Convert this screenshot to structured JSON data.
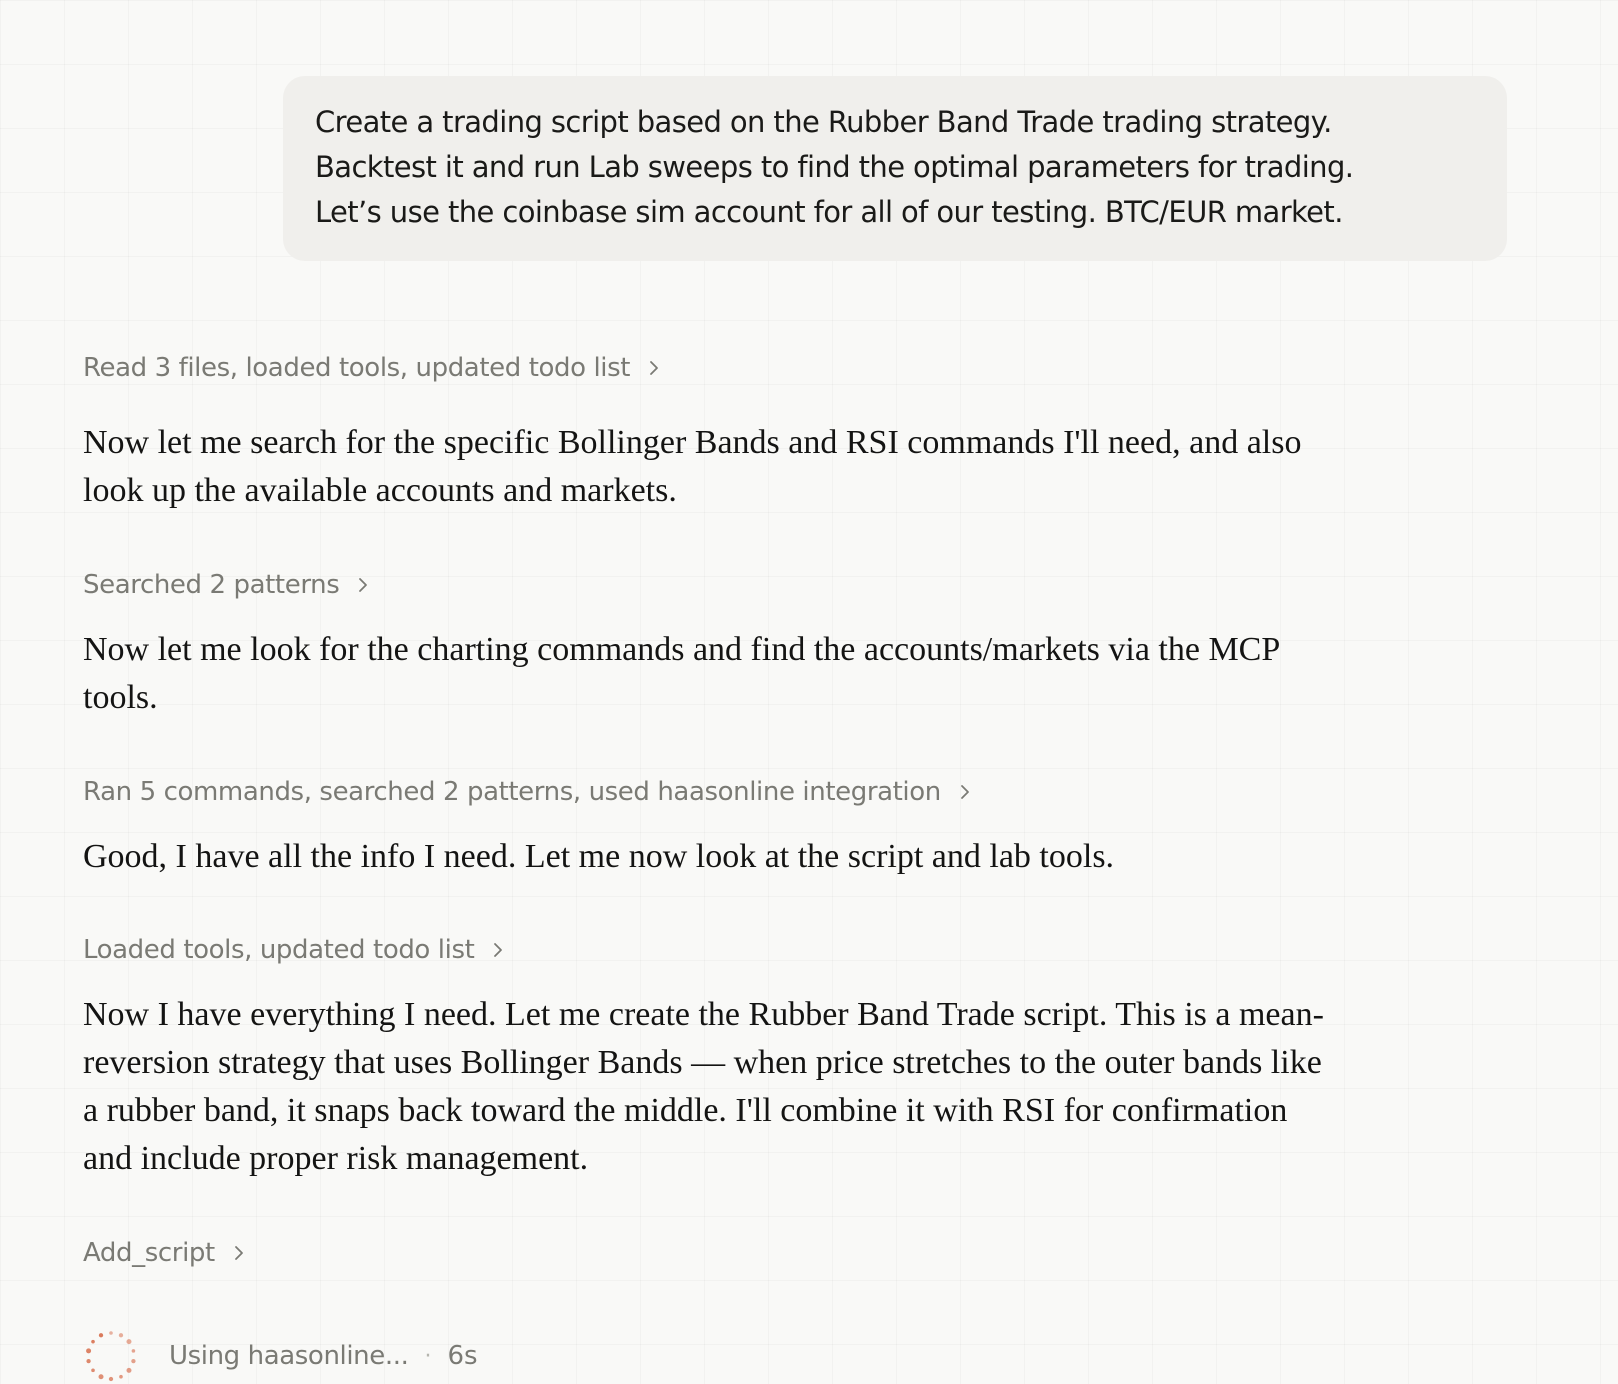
{
  "user_message": {
    "lines": [
      "Create a trading script based on the Rubber Band Trade trading strategy.",
      "Backtest it and run Lab sweeps to find the optimal parameters for trading.",
      "Let’s use the coinbase sim account for all of our testing. BTC/EUR market."
    ]
  },
  "steps": [
    {
      "tool_summary": "Read 3 files, loaded tools, updated todo list",
      "text_lines": [
        "Now let me search for the specific Bollinger Bands and RSI commands I'll need, and also",
        "look up the available accounts and markets."
      ]
    },
    {
      "tool_summary": "Searched 2 patterns",
      "text_lines": [
        "Now let me look for the charting commands and find the accounts/markets via the MCP",
        "tools."
      ]
    },
    {
      "tool_summary": "Ran 5 commands, searched 2 patterns, used haasonline integration",
      "text_lines": [
        "Good, I have all the info I need. Let me now look at the script and lab tools."
      ]
    },
    {
      "tool_summary": "Loaded tools, updated todo list",
      "text_lines": [
        "Now I have everything I need. Let me create the Rubber Band Trade script. This is a mean-",
        "reversion strategy that uses Bollinger Bands — when price stretches to the outer bands like",
        "a rubber band, it snaps back toward the middle. I'll combine it with RSI for confirmation",
        "and include proper risk management."
      ]
    },
    {
      "tool_summary": "Add_script"
    }
  ],
  "status": {
    "label": "Using haasonline...",
    "separator": "·",
    "elapsed": "6s",
    "icon": "spinner-icon",
    "spinner_color": "#d97757"
  },
  "colors": {
    "background": "#f9f9f7",
    "user_bubble": "#f0efec",
    "muted_text": "#7a7a74",
    "body_text": "#141413"
  }
}
